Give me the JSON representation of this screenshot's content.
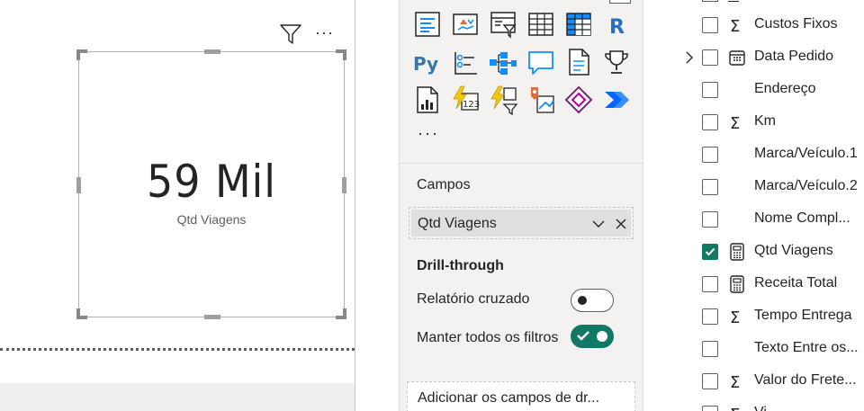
{
  "card": {
    "value": "59 Mil",
    "label": "Qtd Viagens"
  },
  "visual_header": {
    "filter_icon": "filter-icon",
    "more_icon": "more-options-icon",
    "more_text": "···"
  },
  "visualizations": {
    "more_text": "···",
    "icons": [
      "multi-row-card-icon",
      "kpi-icon",
      "slicer-icon",
      "table-icon",
      "matrix-icon",
      "r-visual-icon",
      "python-visual-icon",
      "key-influencers-icon",
      "decomposition-tree-icon",
      "qa-icon",
      "smart-narrative-icon",
      "metrics-icon",
      "paginated-report-icon",
      "azure-map-icon",
      "power-apps-icon",
      "power-automate-icon",
      "get-more-visuals-icon",
      "ai-visual-icon"
    ],
    "fields_label": "Campos",
    "field_pill": "Qtd Viagens",
    "drill_title": "Drill-through",
    "cross_report_label": "Relatório cruzado",
    "cross_report_on": false,
    "keep_filters_label": "Manter todos os filtros",
    "keep_filters_on": true,
    "add_drill_placeholder": "Adicionar os campos de dr..."
  },
  "fields": [
    {
      "name": "Custos Fixos",
      "icon": "sigma-icon",
      "checked": false,
      "expandable": false
    },
    {
      "name": "Data Pedido",
      "icon": "calendar-icon",
      "checked": false,
      "expandable": true
    },
    {
      "name": "Endereço",
      "icon": "",
      "checked": false,
      "expandable": false
    },
    {
      "name": "Km",
      "icon": "sigma-icon",
      "checked": false,
      "expandable": false
    },
    {
      "name": "Marca/Veículo.1",
      "icon": "",
      "checked": false,
      "expandable": false
    },
    {
      "name": "Marca/Veículo.2",
      "icon": "",
      "checked": false,
      "expandable": false
    },
    {
      "name": "Nome Compl...",
      "icon": "",
      "checked": false,
      "expandable": false
    },
    {
      "name": "Qtd Viagens",
      "icon": "calculator-icon",
      "checked": true,
      "expandable": false
    },
    {
      "name": "Receita Total",
      "icon": "calculator-icon",
      "checked": false,
      "expandable": false
    },
    {
      "name": "Tempo Entrega",
      "icon": "sigma-icon",
      "checked": false,
      "expandable": false
    },
    {
      "name": "Texto Entre os...",
      "icon": "",
      "checked": false,
      "expandable": false
    },
    {
      "name": "Valor do Frete...",
      "icon": "sigma-icon",
      "checked": false,
      "expandable": false
    },
    {
      "name": "Vi...",
      "icon": "sigma-icon",
      "checked": false,
      "expandable": false
    }
  ],
  "colors": {
    "accent": "#117865",
    "pane_bg": "#f3f2f1",
    "text": "#252423"
  }
}
